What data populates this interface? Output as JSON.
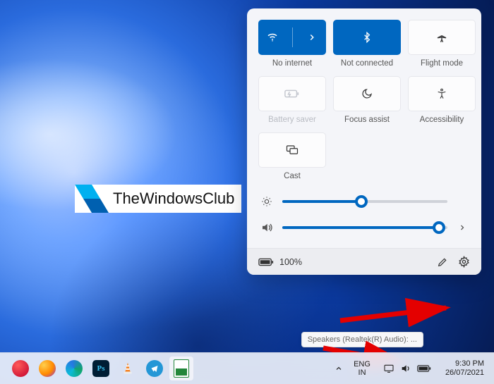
{
  "panel": {
    "tiles": [
      {
        "label": "No internet"
      },
      {
        "label": "Not connected"
      },
      {
        "label": "Flight mode"
      },
      {
        "label": "Battery saver"
      },
      {
        "label": "Focus assist"
      },
      {
        "label": "Accessibility"
      },
      {
        "label": "Cast"
      }
    ],
    "sliders": {
      "brightness_percent": 48,
      "volume_percent": 95
    },
    "footer": {
      "battery_text": "100%"
    }
  },
  "tooltip": "Speakers (Realtek(R) Audio): ...",
  "taskbar": {
    "lang_top": "ENG",
    "lang_bottom": "IN",
    "time": "9:30 PM",
    "date": "26/07/2021"
  },
  "watermark": "TheWindowsClub"
}
